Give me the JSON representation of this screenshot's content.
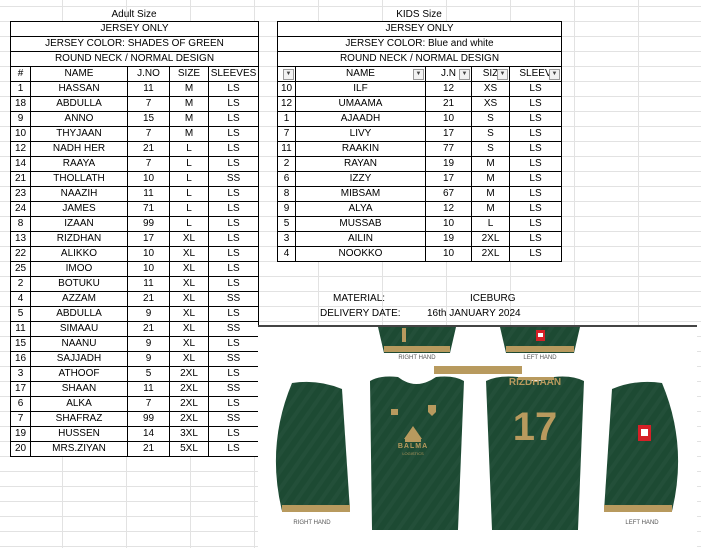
{
  "colors": {
    "jersey": "#1d4a33",
    "gold": "#b89a5e",
    "badge": "#d62027"
  },
  "adult": {
    "caption": "Adult Size",
    "rows": [
      "JERSEY ONLY",
      "JERSEY COLOR: SHADES OF GREEN",
      "ROUND NECK / NORMAL DESIGN"
    ],
    "headers": [
      "#",
      "NAME",
      "J.NO",
      "SIZE",
      "SLEEVES"
    ],
    "data": [
      [
        "1",
        "HASSAN",
        "11",
        "M",
        "LS"
      ],
      [
        "18",
        "ABDULLA",
        "7",
        "M",
        "LS"
      ],
      [
        "9",
        "ANNO",
        "15",
        "M",
        "LS"
      ],
      [
        "10",
        "THYJAAN",
        "7",
        "M",
        "LS"
      ],
      [
        "12",
        "NADH HER",
        "21",
        "L",
        "LS"
      ],
      [
        "14",
        "RAAYA",
        "7",
        "L",
        "LS"
      ],
      [
        "21",
        "THOLLATH",
        "10",
        "L",
        "SS"
      ],
      [
        "23",
        "NAAZIH",
        "11",
        "L",
        "LS"
      ],
      [
        "24",
        "JAMES",
        "71",
        "L",
        "LS"
      ],
      [
        "8",
        "IZAAN",
        "99",
        "L",
        "LS"
      ],
      [
        "13",
        "RIZDHAN",
        "17",
        "XL",
        "LS"
      ],
      [
        "22",
        "ALIKKO",
        "10",
        "XL",
        "LS"
      ],
      [
        "25",
        "IMOO",
        "10",
        "XL",
        "LS"
      ],
      [
        "2",
        "BOTUKU",
        "11",
        "XL",
        "LS"
      ],
      [
        "4",
        "AZZAM",
        "21",
        "XL",
        "SS"
      ],
      [
        "5",
        "ABDULLA",
        "9",
        "XL",
        "LS"
      ],
      [
        "11",
        "SIMAAU",
        "21",
        "XL",
        "SS"
      ],
      [
        "15",
        "NAANU",
        "9",
        "XL",
        "LS"
      ],
      [
        "16",
        "SAJJADH",
        "9",
        "XL",
        "SS"
      ],
      [
        "3",
        "ATHOOF",
        "5",
        "2XL",
        "LS"
      ],
      [
        "17",
        "SHAAN",
        "11",
        "2XL",
        "SS"
      ],
      [
        "6",
        "ALKA",
        "7",
        "2XL",
        "LS"
      ],
      [
        "7",
        "SHAFRAZ",
        "99",
        "2XL",
        "SS"
      ],
      [
        "19",
        "HUSSEN",
        "14",
        "3XL",
        "LS"
      ],
      [
        "20",
        "MRS.ZIYAN",
        "21",
        "5XL",
        "LS"
      ]
    ]
  },
  "kids": {
    "caption": "KIDS Size",
    "rows": [
      "JERSEY ONLY",
      "JERSEY COLOR: Blue and white",
      "ROUND NECK / NORMAL DESIGN"
    ],
    "headers": [
      "",
      "NAME",
      "J.NO",
      "SIZE",
      "SLEEVES"
    ],
    "header_shown": [
      "",
      "NAME",
      "J.N",
      "SIZ",
      "SLEEV"
    ],
    "data": [
      [
        "10",
        "ILF",
        "12",
        "XS",
        "LS"
      ],
      [
        "12",
        "UMAAMA",
        "21",
        "XS",
        "LS"
      ],
      [
        "1",
        "AJAADH",
        "10",
        "S",
        "LS"
      ],
      [
        "7",
        "LIVY",
        "17",
        "S",
        "LS"
      ],
      [
        "11",
        "RAAKIN",
        "77",
        "S",
        "LS"
      ],
      [
        "2",
        "RAYAN",
        "19",
        "M",
        "LS"
      ],
      [
        "6",
        "IZZY",
        "17",
        "M",
        "LS"
      ],
      [
        "8",
        "MIBSAM",
        "67",
        "M",
        "LS"
      ],
      [
        "9",
        "ALYA",
        "12",
        "M",
        "LS"
      ],
      [
        "5",
        "MUSSAB",
        "10",
        "L",
        "LS"
      ],
      [
        "3",
        "AILIN",
        "19",
        "2XL",
        "LS"
      ],
      [
        "4",
        "NOOKKO",
        "10",
        "2XL",
        "LS"
      ]
    ]
  },
  "info": {
    "material_label": "MATERIAL:",
    "material_value": "ICEBURG",
    "delivery_label": "DELIVERY DATE:",
    "delivery_value": "16th JANUARY 2024"
  },
  "design": {
    "right_hand": "RIGHT HAND",
    "left_hand": "LEFT HAND",
    "back_name": "RIZDHAAN",
    "back_number": "17",
    "sponsor": "BALMA",
    "sponsor_sub": "LOGISTICS"
  }
}
